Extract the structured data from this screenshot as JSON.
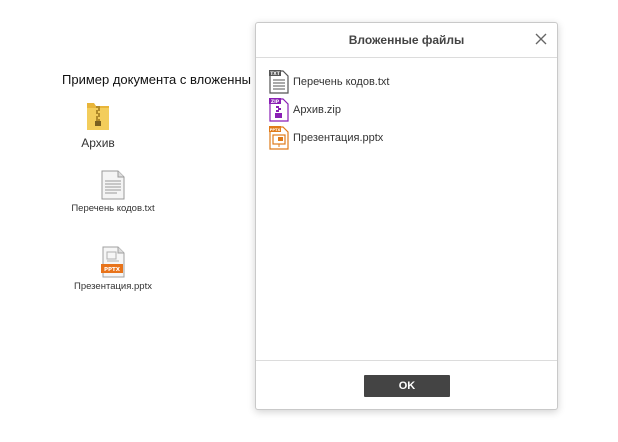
{
  "document": {
    "title": "Пример документа с вложенны",
    "attachments": [
      {
        "label": "Архив",
        "icon": "folder-zip-icon"
      },
      {
        "label": "Перечень кодов.txt",
        "icon": "text-document-icon"
      },
      {
        "label": "Презентация.pptx",
        "icon": "pptx-file-icon",
        "badge": "PPTX"
      }
    ]
  },
  "dialog": {
    "title": "Вложенные файлы",
    "close_icon": "close-icon",
    "files": [
      {
        "name": "Перечень кодов.txt",
        "type_label": "TXT",
        "icon": "txt-file-icon",
        "color": "#555555"
      },
      {
        "name": "Архив.zip",
        "type_label": "ZIP",
        "icon": "zip-file-icon",
        "color": "#8a1fb5"
      },
      {
        "name": "Презентация.pptx",
        "type_label": "PPTX",
        "icon": "pptx-file-icon",
        "color": "#e07b1a"
      }
    ],
    "ok_label": "OK"
  }
}
